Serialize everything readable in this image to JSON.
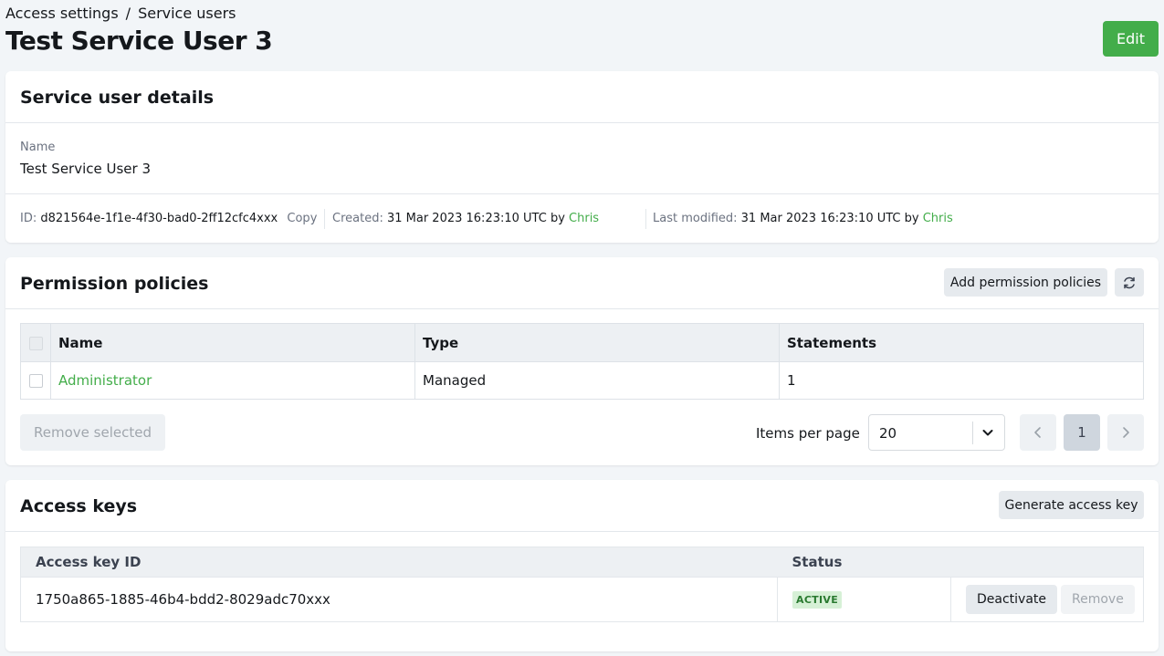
{
  "breadcrumb": {
    "items": [
      "Access settings",
      "Service users"
    ],
    "separator": "/"
  },
  "page": {
    "title": "Test Service User 3",
    "edit_label": "Edit"
  },
  "details": {
    "card_title": "Service user details",
    "name_label": "Name",
    "name_value": "Test Service User 3",
    "id_label": "ID:",
    "id_value": "d821564e-1f1e-4f30-bad0-2ff12cfc4xxx",
    "copy_label": "Copy",
    "created_label": "Created:",
    "created_value": "31 Mar 2023 16:23:10 UTC by",
    "created_by": "Chris",
    "modified_label": "Last modified:",
    "modified_value": "31 Mar 2023 16:23:10 UTC by",
    "modified_by": "Chris"
  },
  "policies": {
    "card_title": "Permission policies",
    "add_label": "Add permission policies",
    "refresh_icon": "refresh-icon",
    "columns": [
      "Name",
      "Type",
      "Statements"
    ],
    "rows": [
      {
        "name": "Administrator",
        "type": "Managed",
        "statements": "1"
      }
    ],
    "remove_selected_label": "Remove selected",
    "items_per_page_label": "Items per page",
    "items_per_page_value": "20",
    "current_page": "1"
  },
  "access_keys": {
    "card_title": "Access keys",
    "generate_label": "Generate access key",
    "columns": [
      "Access key ID",
      "Status"
    ],
    "rows": [
      {
        "id": "1750a865-1885-46b4-bdd2-8029adc70xxx",
        "status": "ACTIVE",
        "deactivate_label": "Deactivate",
        "remove_label": "Remove"
      }
    ]
  },
  "colors": {
    "accent": "#43ad4a",
    "background": "#f2f5f8",
    "status_active_bg": "#d6f0d6"
  }
}
